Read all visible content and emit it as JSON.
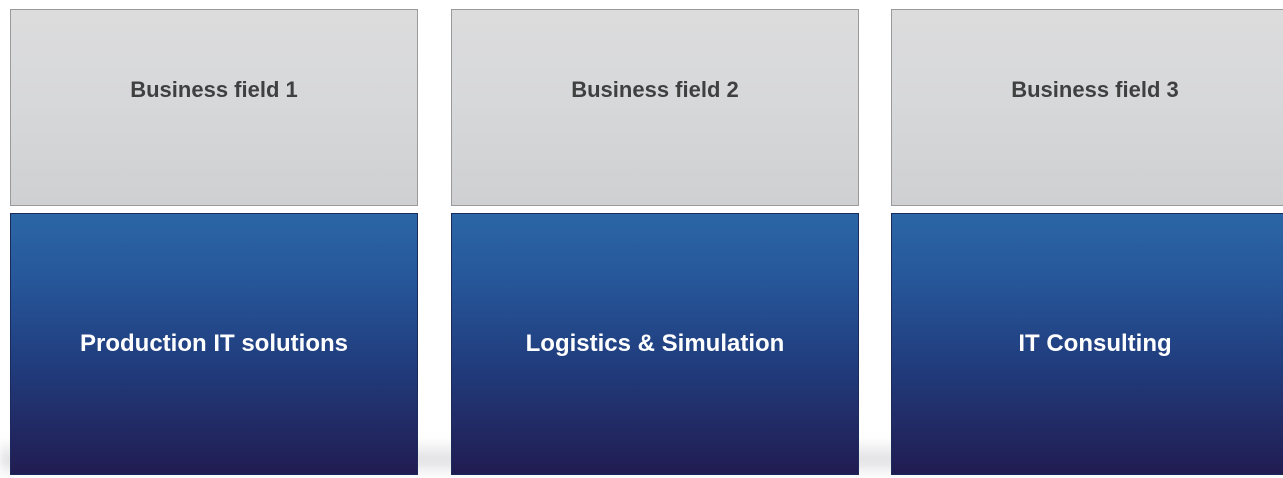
{
  "columns": [
    {
      "field": "Business field 1",
      "solution": "Production IT solutions"
    },
    {
      "field": "Business field 2",
      "solution": "Logistics & Simulation"
    },
    {
      "field": "Business field 3",
      "solution": "IT Consulting"
    }
  ],
  "colors": {
    "field_fill": "#d7d8da",
    "field_text": "#404040",
    "solution_fill_top": "#2b66a6",
    "solution_fill_bottom": "#211c52",
    "solution_text": "#ffffff"
  }
}
